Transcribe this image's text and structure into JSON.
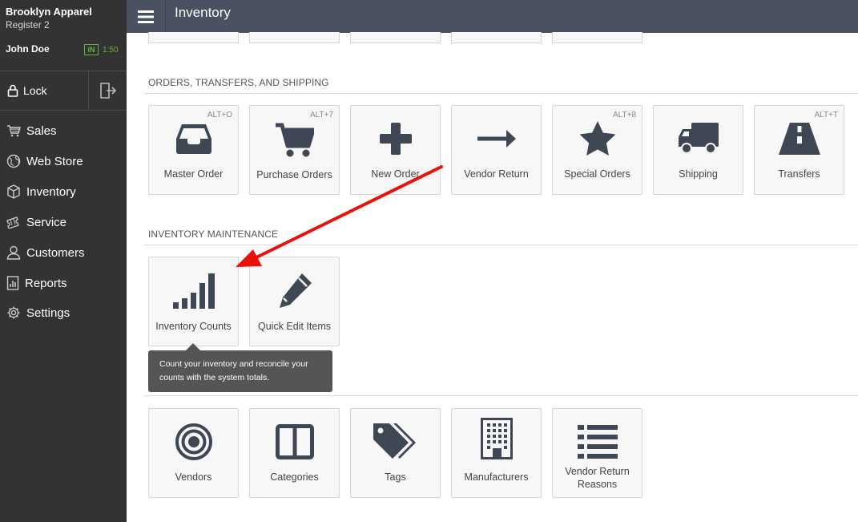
{
  "sidebar": {
    "store_name": "Brooklyn Apparel",
    "register": "Register 2",
    "user": "John Doe",
    "clock_status": "IN",
    "clock_time": "1:50",
    "lock_label": "Lock",
    "logout_icon": "logout-icon",
    "items": [
      {
        "label": "Sales",
        "icon": "cart-icon"
      },
      {
        "label": "Web Store",
        "icon": "globe-icon"
      },
      {
        "label": "Inventory",
        "icon": "box-icon"
      },
      {
        "label": "Service",
        "icon": "ticket-icon"
      },
      {
        "label": "Customers",
        "icon": "person-icon"
      },
      {
        "label": "Reports",
        "icon": "report-icon"
      },
      {
        "label": "Settings",
        "icon": "gear-icon"
      }
    ]
  },
  "header": {
    "menu_icon": "hamburger-icon",
    "title": "Inventory"
  },
  "sections": {
    "orders": {
      "title": "ORDERS, TRANSFERS, AND SHIPPING",
      "tiles": [
        {
          "label": "Master Order",
          "shortcut": "ALT+O",
          "icon": "inbox-icon"
        },
        {
          "label": "Purchase Orders",
          "shortcut": "ALT+7",
          "icon": "cart-icon"
        },
        {
          "label": "New Order",
          "shortcut": "",
          "icon": "plus-icon"
        },
        {
          "label": "Vendor Return",
          "shortcut": "",
          "icon": "arrow-right-icon"
        },
        {
          "label": "Special Orders",
          "shortcut": "ALT+8",
          "icon": "star-icon"
        },
        {
          "label": "Shipping",
          "shortcut": "",
          "icon": "truck-icon"
        },
        {
          "label": "Transfers",
          "shortcut": "ALT+T",
          "icon": "road-icon"
        }
      ]
    },
    "maintenance": {
      "title": "INVENTORY MAINTENANCE",
      "tiles": [
        {
          "label": "Inventory Counts",
          "icon": "signal-bars-icon"
        },
        {
          "label": "Quick Edit Items",
          "icon": "pencil-icon"
        }
      ],
      "tooltip": "Count your inventory and reconcile your counts with the system totals."
    },
    "catalog": {
      "tiles": [
        {
          "label": "Vendors",
          "icon": "target-icon"
        },
        {
          "label": "Categories",
          "icon": "columns-icon"
        },
        {
          "label": "Tags",
          "icon": "tags-icon"
        },
        {
          "label": "Manufacturers",
          "icon": "building-icon"
        },
        {
          "label": "Vendor Return Reasons",
          "icon": "list-icon"
        }
      ]
    }
  },
  "colors": {
    "sidebar_bg": "#333333",
    "topbar_bg": "#4a5261",
    "icon_color": "#3f4654",
    "clock_green": "#5fb636",
    "annotation_arrow": "#e8120c"
  }
}
